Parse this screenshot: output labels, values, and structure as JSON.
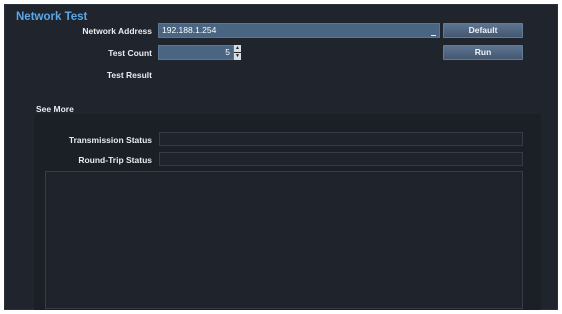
{
  "window": {
    "title": "Network Test"
  },
  "form": {
    "address_label": "Network Address",
    "address_value": "192.188.1.254",
    "default_button": "Default",
    "count_label": "Test Count",
    "count_value": "5",
    "run_button": "Run",
    "result_label": "Test Result",
    "result_value": ""
  },
  "see_more": {
    "title": "See More",
    "transmission_label": "Transmission Status",
    "transmission_value": "",
    "roundtrip_label": "Round-Trip Status",
    "roundtrip_value": "",
    "log_text": ""
  },
  "icons": {
    "spinner_up": "triangle-up-icon",
    "spinner_down": "triangle-down-icon"
  },
  "colors": {
    "background": "#20252d",
    "title": "#5aa7e8",
    "input_fill": "#496582",
    "button_fill": "#536a86"
  }
}
